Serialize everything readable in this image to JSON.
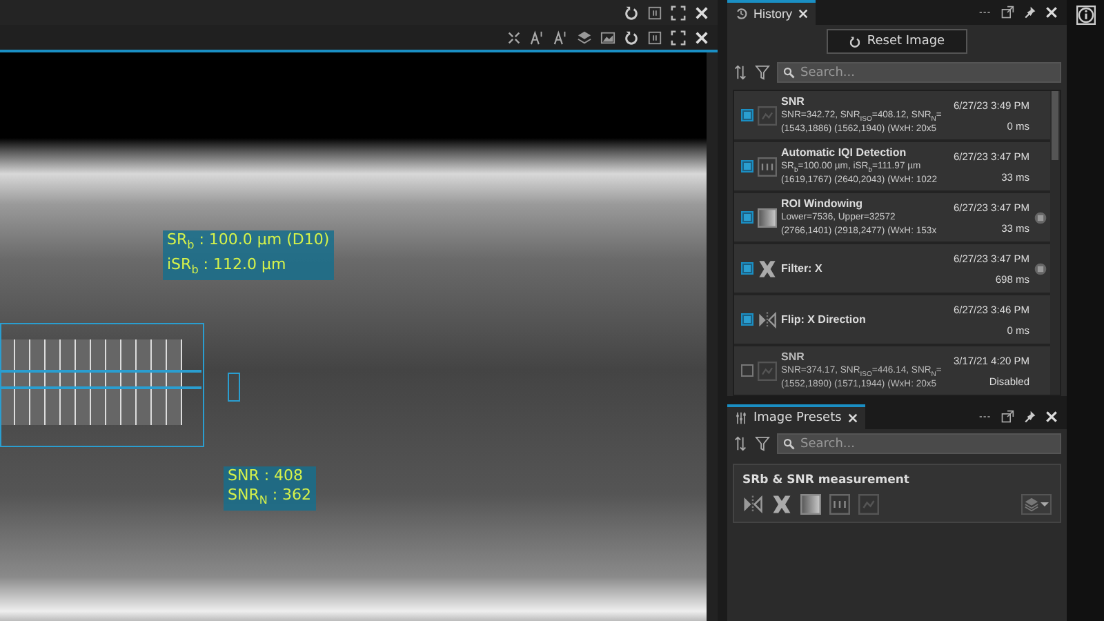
{
  "viewer": {
    "overlays": [
      {
        "kind": "resolution",
        "lines": [
          "SR$_{b}$ : 100.0 µm (D10)",
          "iSR$_{b}$ : 112.0 µm"
        ]
      },
      {
        "kind": "snr",
        "lines": [
          "SNR : 408",
          "SNR$_{N}$ : 362"
        ]
      }
    ]
  },
  "history": {
    "title": "History",
    "reset_button": "Reset Image",
    "search": {
      "placeholder": "Search..."
    },
    "items": [
      {
        "kind": "snr",
        "checked": true,
        "title": "SNR",
        "details": [
          "SNR=342.72, SNR$_{ISO}$=408.12, SNR$_{N}$=",
          "(1543,1886) (1562,1940) (WxH: 20x5"
        ],
        "date": "6/27/23 3:49 PM",
        "duration": "0 ms",
        "badge": false
      },
      {
        "kind": "iqi",
        "checked": true,
        "title": "Automatic IQI Detection",
        "details": [
          "SR$_{b}$=100.00 µm, iSR$_{b}$=111.97 µm",
          "(1619,1767) (2640,2043) (WxH: 1022"
        ],
        "date": "6/27/23 3:47 PM",
        "duration": "33 ms",
        "badge": false
      },
      {
        "kind": "roi",
        "checked": true,
        "title": "ROI Windowing",
        "details": [
          "Lower=7536, Upper=32572",
          "(2766,1401) (2918,2477) (WxH: 153x"
        ],
        "date": "6/27/23 3:47 PM",
        "duration": "33 ms",
        "badge": true
      },
      {
        "kind": "filter",
        "checked": true,
        "title": "Filter: X",
        "date": "6/27/23 3:47 PM",
        "duration": "698 ms",
        "badge": true
      },
      {
        "kind": "flip",
        "checked": true,
        "title": "Flip: X Direction",
        "date": "6/27/23 3:46 PM",
        "duration": "0 ms",
        "badge": false
      },
      {
        "kind": "snr",
        "checked": false,
        "title": "SNR",
        "details": [
          "SNR=374.17, SNR$_{ISO}$=446.14, SNR$_{N}$=",
          "(1552,1890) (1571,1944) (WxH: 20x5"
        ],
        "date": "3/17/21 4:20 PM",
        "duration": "Disabled",
        "badge": false
      }
    ]
  },
  "presets": {
    "title": "Image Presets",
    "search": {
      "placeholder": "Search..."
    },
    "cards": [
      {
        "title": "SRb & SNR measurement",
        "tools": [
          {
            "kind": "flip"
          },
          {
            "kind": "filter"
          },
          {
            "kind": "roi"
          },
          {
            "kind": "iqi"
          },
          {
            "kind": "snr"
          }
        ]
      }
    ]
  }
}
